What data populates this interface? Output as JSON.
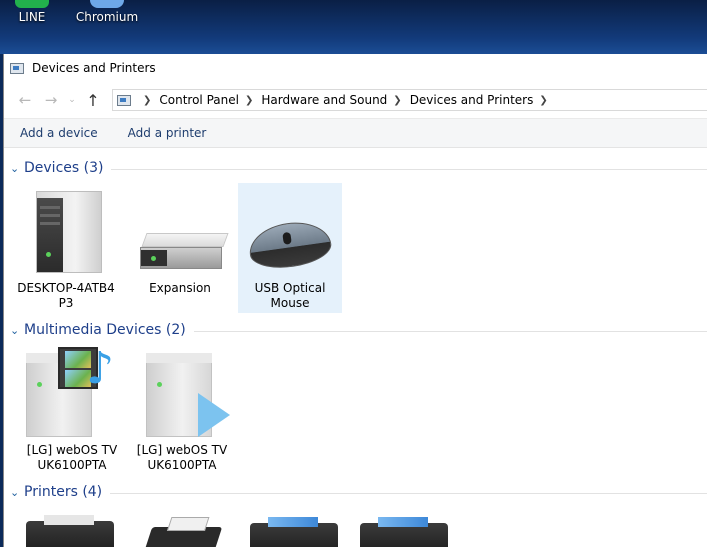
{
  "desktop": {
    "icons": [
      {
        "label": "LINE",
        "icon": "line-app-icon"
      },
      {
        "label": "Chromium",
        "icon": "chromium-icon"
      }
    ]
  },
  "window": {
    "title": "Devices and Printers",
    "breadcrumbs": [
      "Control Panel",
      "Hardware and Sound",
      "Devices and Printers"
    ],
    "commands": [
      "Add a device",
      "Add a printer"
    ]
  },
  "groups": {
    "devices": {
      "title": "Devices (3)",
      "items": [
        {
          "label_line1": "DESKTOP-4ATB4",
          "label_line2": "P3"
        },
        {
          "label_line1": "Expansion",
          "label_line2": ""
        },
        {
          "label_line1": "USB Optical",
          "label_line2": "Mouse"
        }
      ]
    },
    "multimedia": {
      "title": "Multimedia Devices (2)",
      "items": [
        {
          "label_line1": "[LG] webOS TV",
          "label_line2": "UK6100PTA"
        },
        {
          "label_line1": "[LG] webOS TV",
          "label_line2": "UK6100PTA"
        }
      ]
    },
    "printers": {
      "title": "Printers (4)"
    }
  },
  "colors": {
    "group_title": "#1e3f8a",
    "command_text": "#1e3d6e",
    "selection": "#e5f1fb"
  }
}
